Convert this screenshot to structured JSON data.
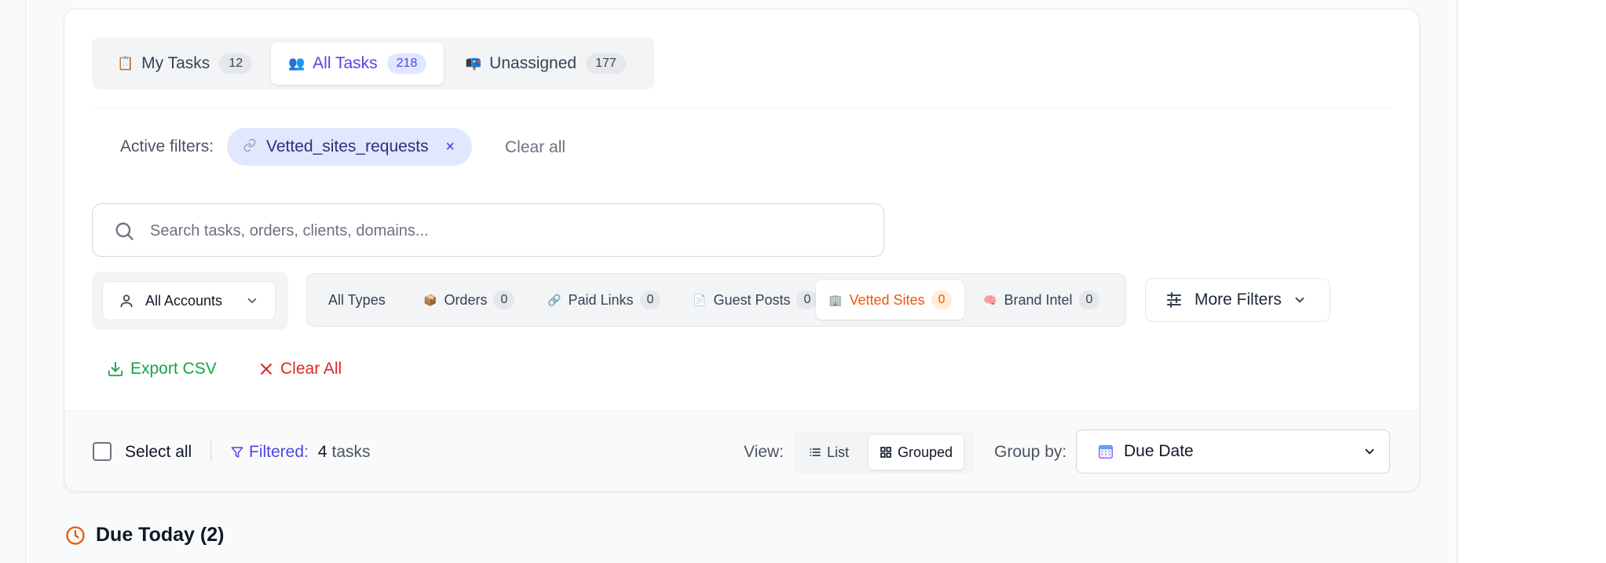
{
  "tabs": [
    {
      "emoji": "📋",
      "label": "My Tasks",
      "count": "12"
    },
    {
      "emoji": "👥",
      "label": "All Tasks",
      "count": "218"
    },
    {
      "emoji": "📭",
      "label": "Unassigned",
      "count": "177"
    }
  ],
  "active_filters": {
    "label": "Active filters:",
    "chip_label": "Vetted_sites_requests",
    "chip_icon": "link-icon",
    "chip_remove": "×",
    "clear_label": "Clear all"
  },
  "search": {
    "placeholder": "Search tasks, orders, clients, domains..."
  },
  "account_select": {
    "value": "All Accounts"
  },
  "types": [
    {
      "emoji": "",
      "label": "All Types",
      "count": ""
    },
    {
      "emoji": "📦",
      "label": "Orders",
      "count": "0"
    },
    {
      "emoji": "🔗",
      "label": "Paid Links",
      "count": "0"
    },
    {
      "emoji": "📄",
      "label": "Guest Posts",
      "count": "0"
    },
    {
      "emoji": "🏢",
      "label": "Vetted Sites",
      "count": "0"
    },
    {
      "emoji": "🧠",
      "label": "Brand Intel",
      "count": "0"
    }
  ],
  "more_filters": {
    "label": "More Filters"
  },
  "actions": {
    "export_label": "Export CSV",
    "clear_all_label": "Clear All"
  },
  "footer": {
    "select_all": "Select all",
    "filtered_label": "Filtered:",
    "filtered_count": "4",
    "filtered_unit": "tasks",
    "view_label": "View:",
    "view_list": "List",
    "view_grouped": "Grouped",
    "groupby_label": "Group by:",
    "groupby_value": "Due Date"
  },
  "section": {
    "title": "Due Today (2)"
  },
  "colors": {
    "accent": "#4f46e5",
    "orange": "#ea580c",
    "green": "#16a34a",
    "red": "#dc2626"
  }
}
